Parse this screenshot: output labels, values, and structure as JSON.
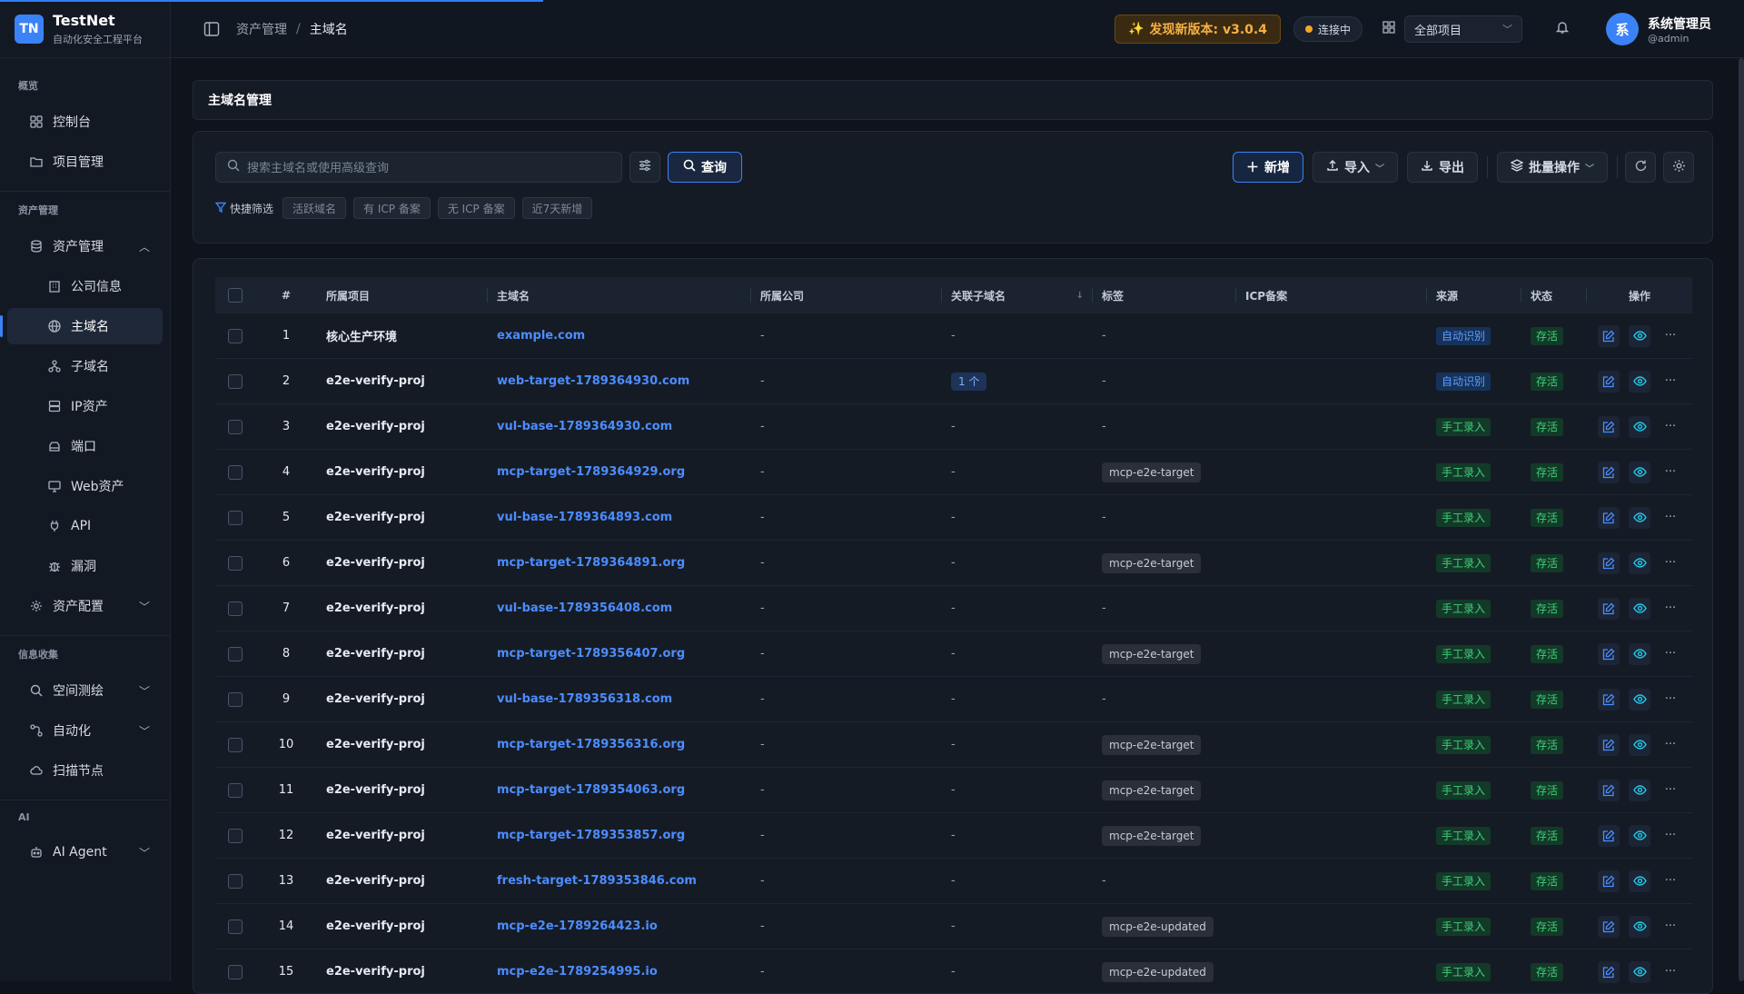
{
  "app": {
    "logo_text": "TN",
    "name": "TestNet",
    "subtitle": "自动化安全工程平台"
  },
  "sidebar": {
    "sections": [
      {
        "title": "概览"
      },
      {
        "title": "资产管理"
      },
      {
        "title": "信息收集"
      },
      {
        "title": "AI"
      }
    ],
    "items": [
      {
        "label": "控制台",
        "icon": "dashboard-icon"
      },
      {
        "label": "项目管理",
        "icon": "folder-icon"
      },
      {
        "label": "资产管理",
        "icon": "database-icon",
        "expanded": true
      },
      {
        "label": "公司信息",
        "icon": "building-icon"
      },
      {
        "label": "主域名",
        "icon": "globe-icon",
        "active": true
      },
      {
        "label": "子域名",
        "icon": "sitemap-icon"
      },
      {
        "label": "IP资产",
        "icon": "server-icon"
      },
      {
        "label": "端口",
        "icon": "port-icon"
      },
      {
        "label": "Web资产",
        "icon": "monitor-icon"
      },
      {
        "label": "API",
        "icon": "plug-icon"
      },
      {
        "label": "漏洞",
        "icon": "bug-icon"
      },
      {
        "label": "资产配置",
        "icon": "gear-icon"
      },
      {
        "label": "空间测绘",
        "icon": "search-icon"
      },
      {
        "label": "自动化",
        "icon": "workflow-icon"
      },
      {
        "label": "扫描节点",
        "icon": "cloud-icon"
      },
      {
        "label": "AI Agent",
        "icon": "robot-icon"
      }
    ]
  },
  "header": {
    "breadcrumb": [
      "资产管理",
      "主域名"
    ],
    "update_label": "发现新版本: v3.0.4",
    "connection_label": "连接中",
    "project_select": "全部项目",
    "user_avatar": "系",
    "user_name": "系统管理员",
    "user_handle": "@admin"
  },
  "page": {
    "title": "主域名管理"
  },
  "toolbar": {
    "search_placeholder": "搜索主域名或使用高级查询",
    "query_label": "查询",
    "quick_filter_label": "快捷筛选",
    "quick_filters": [
      "活跃域名",
      "有 ICP 备案",
      "无 ICP 备案",
      "近7天新增"
    ],
    "add_label": "新增",
    "import_label": "导入",
    "export_label": "导出",
    "batch_label": "批量操作"
  },
  "table": {
    "columns": [
      "#",
      "所属项目",
      "主域名",
      "所属公司",
      "关联子域名",
      "标签",
      "ICP备案",
      "来源",
      "状态",
      "操作"
    ],
    "rows": [
      {
        "idx": "1",
        "project": "核心生产环境",
        "domain": "example.com",
        "company": "-",
        "subdomains": "-",
        "tag": "-",
        "icp": "",
        "source": "自动识别",
        "status": "存活"
      },
      {
        "idx": "2",
        "project": "e2e-verify-proj",
        "domain": "web-target-1789364930.com",
        "company": "-",
        "subdomains": "1 个",
        "tag": "-",
        "icp": "",
        "source": "自动识别",
        "status": "存活"
      },
      {
        "idx": "3",
        "project": "e2e-verify-proj",
        "domain": "vul-base-1789364930.com",
        "company": "-",
        "subdomains": "-",
        "tag": "-",
        "icp": "",
        "source": "手工录入",
        "status": "存活"
      },
      {
        "idx": "4",
        "project": "e2e-verify-proj",
        "domain": "mcp-target-1789364929.org",
        "company": "-",
        "subdomains": "-",
        "tag": "mcp-e2e-target",
        "icp": "",
        "source": "手工录入",
        "status": "存活"
      },
      {
        "idx": "5",
        "project": "e2e-verify-proj",
        "domain": "vul-base-1789364893.com",
        "company": "-",
        "subdomains": "-",
        "tag": "-",
        "icp": "",
        "source": "手工录入",
        "status": "存活"
      },
      {
        "idx": "6",
        "project": "e2e-verify-proj",
        "domain": "mcp-target-1789364891.org",
        "company": "-",
        "subdomains": "-",
        "tag": "mcp-e2e-target",
        "icp": "",
        "source": "手工录入",
        "status": "存活"
      },
      {
        "idx": "7",
        "project": "e2e-verify-proj",
        "domain": "vul-base-1789356408.com",
        "company": "-",
        "subdomains": "-",
        "tag": "-",
        "icp": "",
        "source": "手工录入",
        "status": "存活"
      },
      {
        "idx": "8",
        "project": "e2e-verify-proj",
        "domain": "mcp-target-1789356407.org",
        "company": "-",
        "subdomains": "-",
        "tag": "mcp-e2e-target",
        "icp": "",
        "source": "手工录入",
        "status": "存活"
      },
      {
        "idx": "9",
        "project": "e2e-verify-proj",
        "domain": "vul-base-1789356318.com",
        "company": "-",
        "subdomains": "-",
        "tag": "-",
        "icp": "",
        "source": "手工录入",
        "status": "存活"
      },
      {
        "idx": "10",
        "project": "e2e-verify-proj",
        "domain": "mcp-target-1789356316.org",
        "company": "-",
        "subdomains": "-",
        "tag": "mcp-e2e-target",
        "icp": "",
        "source": "手工录入",
        "status": "存活"
      },
      {
        "idx": "11",
        "project": "e2e-verify-proj",
        "domain": "mcp-target-1789354063.org",
        "company": "-",
        "subdomains": "-",
        "tag": "mcp-e2e-target",
        "icp": "",
        "source": "手工录入",
        "status": "存活"
      },
      {
        "idx": "12",
        "project": "e2e-verify-proj",
        "domain": "mcp-target-1789353857.org",
        "company": "-",
        "subdomains": "-",
        "tag": "mcp-e2e-target",
        "icp": "",
        "source": "手工录入",
        "status": "存活"
      },
      {
        "idx": "13",
        "project": "e2e-verify-proj",
        "domain": "fresh-target-1789353846.com",
        "company": "-",
        "subdomains": "-",
        "tag": "-",
        "icp": "",
        "source": "手工录入",
        "status": "存活"
      },
      {
        "idx": "14",
        "project": "e2e-verify-proj",
        "domain": "mcp-e2e-1789264423.io",
        "company": "-",
        "subdomains": "-",
        "tag": "mcp-e2e-updated",
        "icp": "",
        "source": "手工录入",
        "status": "存活"
      },
      {
        "idx": "15",
        "project": "e2e-verify-proj",
        "domain": "mcp-e2e-1789254995.io",
        "company": "-",
        "subdomains": "-",
        "tag": "mcp-e2e-updated",
        "icp": "",
        "source": "手工录入",
        "status": "存活"
      }
    ]
  },
  "colors": {
    "accent": "#3b82f6",
    "link": "#4c8dff",
    "success": "#3fcf7a",
    "warning": "#f5b041"
  }
}
